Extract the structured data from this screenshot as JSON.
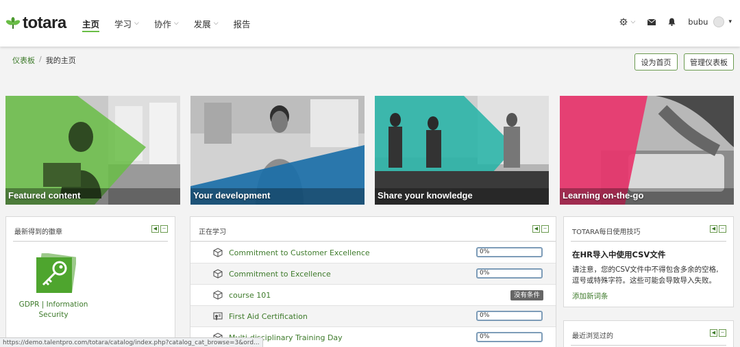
{
  "header": {
    "logo_text": "totara",
    "nav": [
      {
        "label": "主页",
        "active": true,
        "dropdown": false
      },
      {
        "label": "学习",
        "active": false,
        "dropdown": true
      },
      {
        "label": "协作",
        "active": false,
        "dropdown": true
      },
      {
        "label": "发展",
        "active": false,
        "dropdown": true
      },
      {
        "label": "报告",
        "active": false,
        "dropdown": false
      }
    ],
    "user_name": "bubu"
  },
  "breadcrumb": {
    "parent": "仪表板",
    "current": "我的主页"
  },
  "buttons": {
    "set_home": "设为首页",
    "manage": "管理仪表板"
  },
  "tiles": [
    {
      "label": "Featured content",
      "color": "#69BD45"
    },
    {
      "label": "Your development",
      "color": "#1B6FA8"
    },
    {
      "label": "Share your knowledge",
      "color": "#22B3A6"
    },
    {
      "label": "Learning on-the-go",
      "color": "#E8356D"
    }
  ],
  "badges_block": {
    "title": "最新得到的徽章",
    "badge_label_1": "GDPR | Information",
    "badge_label_2": "Security"
  },
  "learning_block": {
    "title": "正在学习",
    "rows": [
      {
        "name": "Commitment to Customer Excellence",
        "progress": "0%",
        "type": "course"
      },
      {
        "name": "Commitment to Excellence",
        "progress": "0%",
        "type": "course"
      },
      {
        "name": "course 101",
        "status": "没有条件",
        "type": "course"
      },
      {
        "name": "First Aid Certification",
        "progress": "0%",
        "type": "certification"
      },
      {
        "name": "Multi-disciplinary Training Day",
        "progress": "0%",
        "type": "course"
      }
    ]
  },
  "tips_block": {
    "title": "TOTARA每日使用技巧",
    "heading": "在HR导入中使用CSV文件",
    "body_1": "请注意，您的CSV文件中不得包含多余的空格,",
    "body_2": "逗号或特殊字符。这些可能会导致导入失败。",
    "link": "添加新词条"
  },
  "recent_block": {
    "title": "最近浏览过的"
  },
  "status_url": "https://demo.talentpro.com/totara/catalog/index.php?catalog_cat_browse=3&ord..."
}
